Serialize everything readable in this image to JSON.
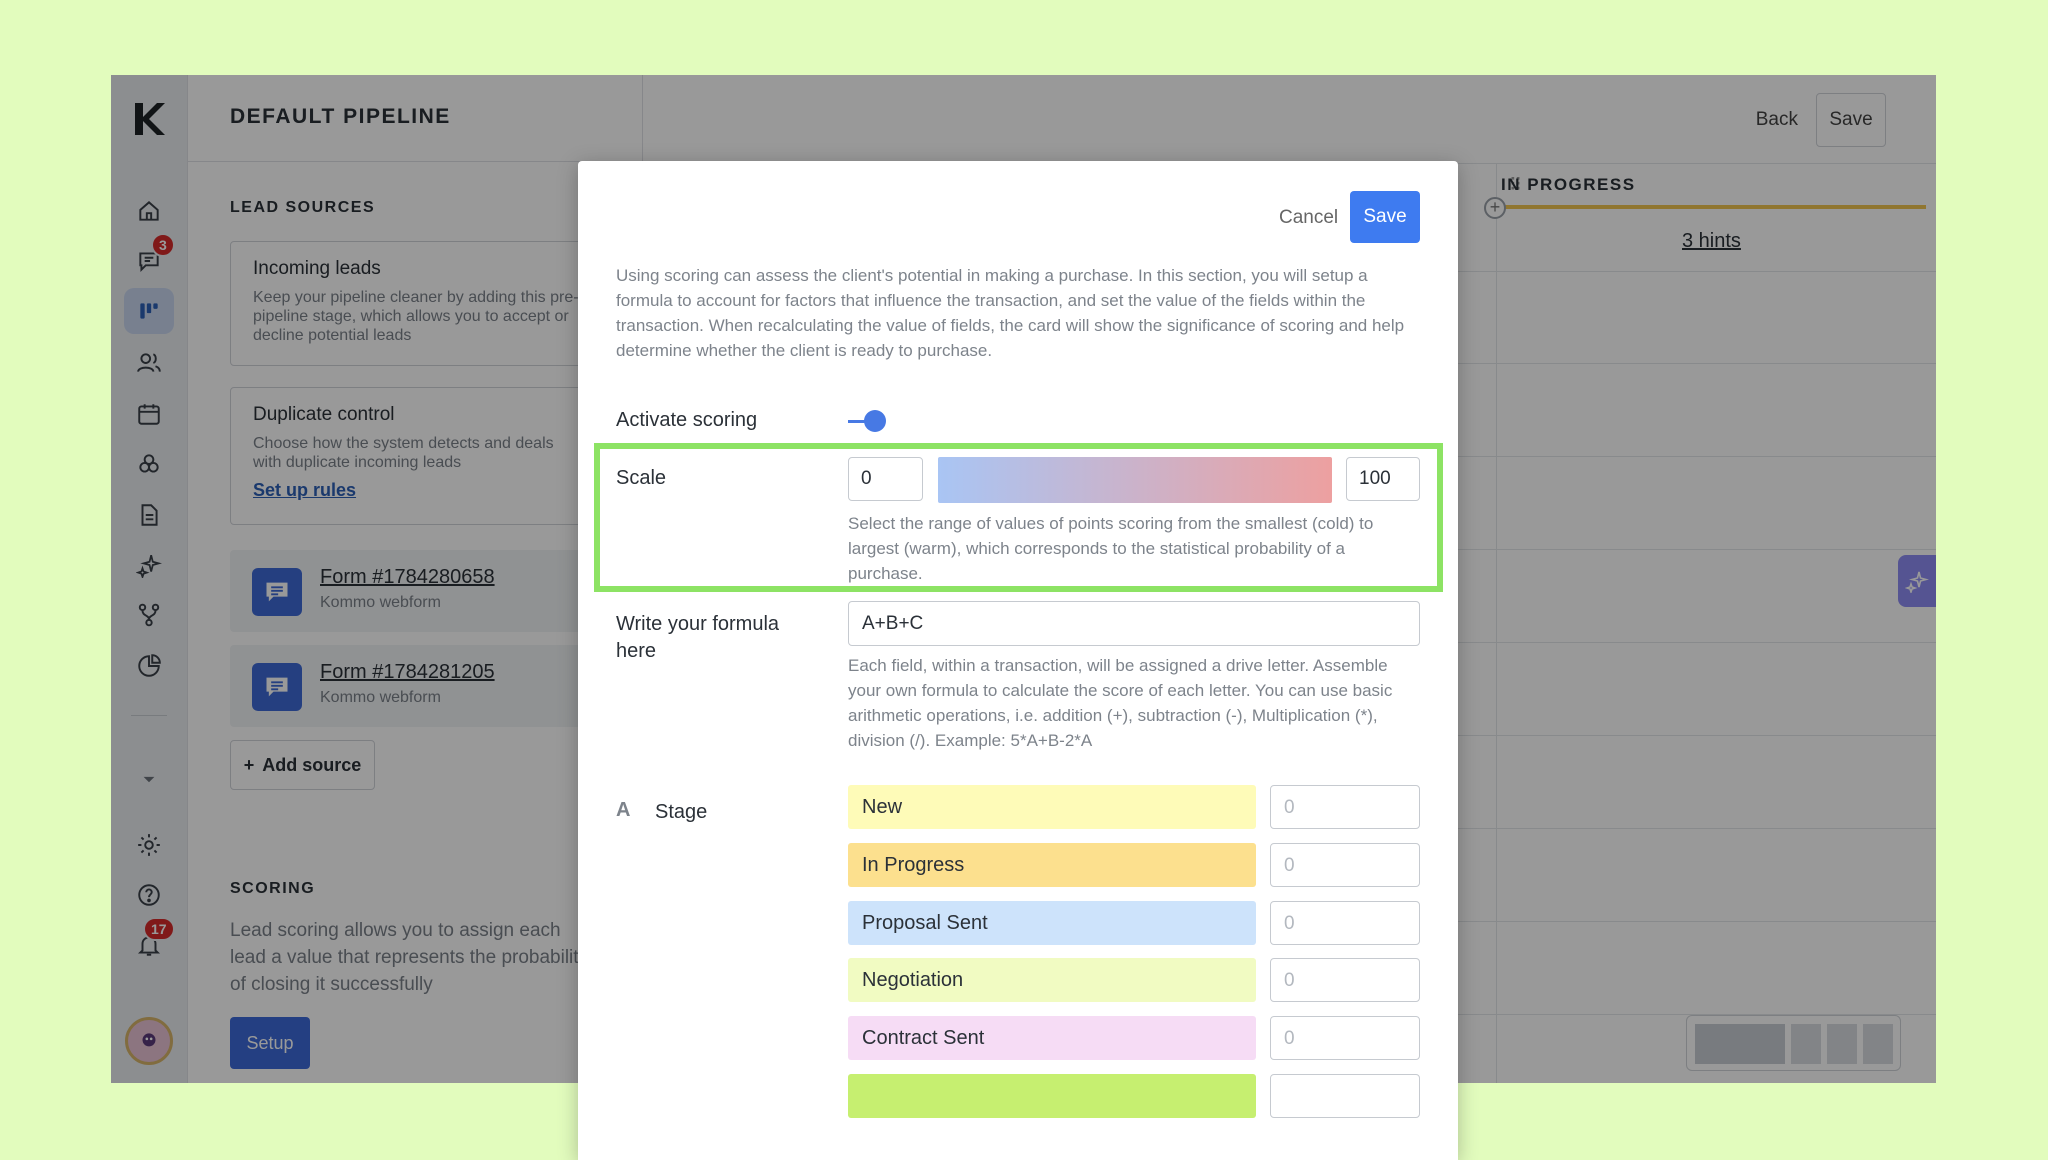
{
  "pipeline": {
    "title": "DEFAULT PIPELINE"
  },
  "rail": {
    "messages_badge": "3",
    "notifications_badge": "17"
  },
  "panel": {
    "lead_sources_title": "LEAD SOURCES",
    "incoming": {
      "title": "Incoming leads",
      "desc": "Keep your pipeline cleaner by adding this pre-pipeline stage, which allows you to accept or decline potential leads"
    },
    "duplicate": {
      "title": "Duplicate control",
      "desc": "Choose how the system detects and deals with duplicate incoming leads",
      "link": "Set up rules"
    },
    "forms": [
      {
        "title": "Form #1784280658",
        "sub": "Kommo webform"
      },
      {
        "title": "Form #1784281205",
        "sub": "Kommo webform"
      }
    ],
    "add_source": "Add source",
    "scoring_title": "SCORING",
    "scoring_desc": "Lead scoring allows you to assign each lead a value that represents the probability of closing it successfully",
    "setup": "Setup"
  },
  "topbar": {
    "back": "Back",
    "save": "Save"
  },
  "board": {
    "column_title": "IN PROGRESS",
    "hints": "3 hints"
  },
  "modal": {
    "cancel": "Cancel",
    "save": "Save",
    "intro": "Using scoring can assess the client's potential in making a purchase. In this section, you will setup a formula to account for factors that influence the transaction, and set the value of the fields within the transaction. When recalculating the value of fields, the card will show the significance of scoring and help determine whether the client is ready to purchase.",
    "activate_label": "Activate scoring",
    "scale_label": "Scale",
    "scale_min": "0",
    "scale_max": "100",
    "scale_help": "Select the range of values of points scoring from the smallest (cold) to largest (warm), which corresponds to the statistical probability of a purchase.",
    "formula_label": "Write your formula here",
    "formula_value": "A+B+C",
    "formula_help": "Each field, within a transaction, will be assigned a drive letter. Assemble your own formula to calculate the score of each letter. You can use basic arithmetic operations, i.e. addition (+), subtraction (-), Multiplication (*), division (/). Example: 5*A+B-2*A",
    "field_letter": "A",
    "field_label": "Stage",
    "stages": [
      {
        "name": "New",
        "value": "0",
        "color": "#fefbb8"
      },
      {
        "name": "In Progress",
        "value": "0",
        "color": "#fce08e"
      },
      {
        "name": "Proposal Sent",
        "value": "0",
        "color": "#cde3fb"
      },
      {
        "name": "Negotiation",
        "value": "0",
        "color": "#f1fbc2"
      },
      {
        "name": "Contract Sent",
        "value": "0",
        "color": "#f6dcf5"
      }
    ]
  },
  "colors": {
    "accent": "#3e7bf0",
    "highlight": "#8de364",
    "background": "#e2fcbd"
  }
}
